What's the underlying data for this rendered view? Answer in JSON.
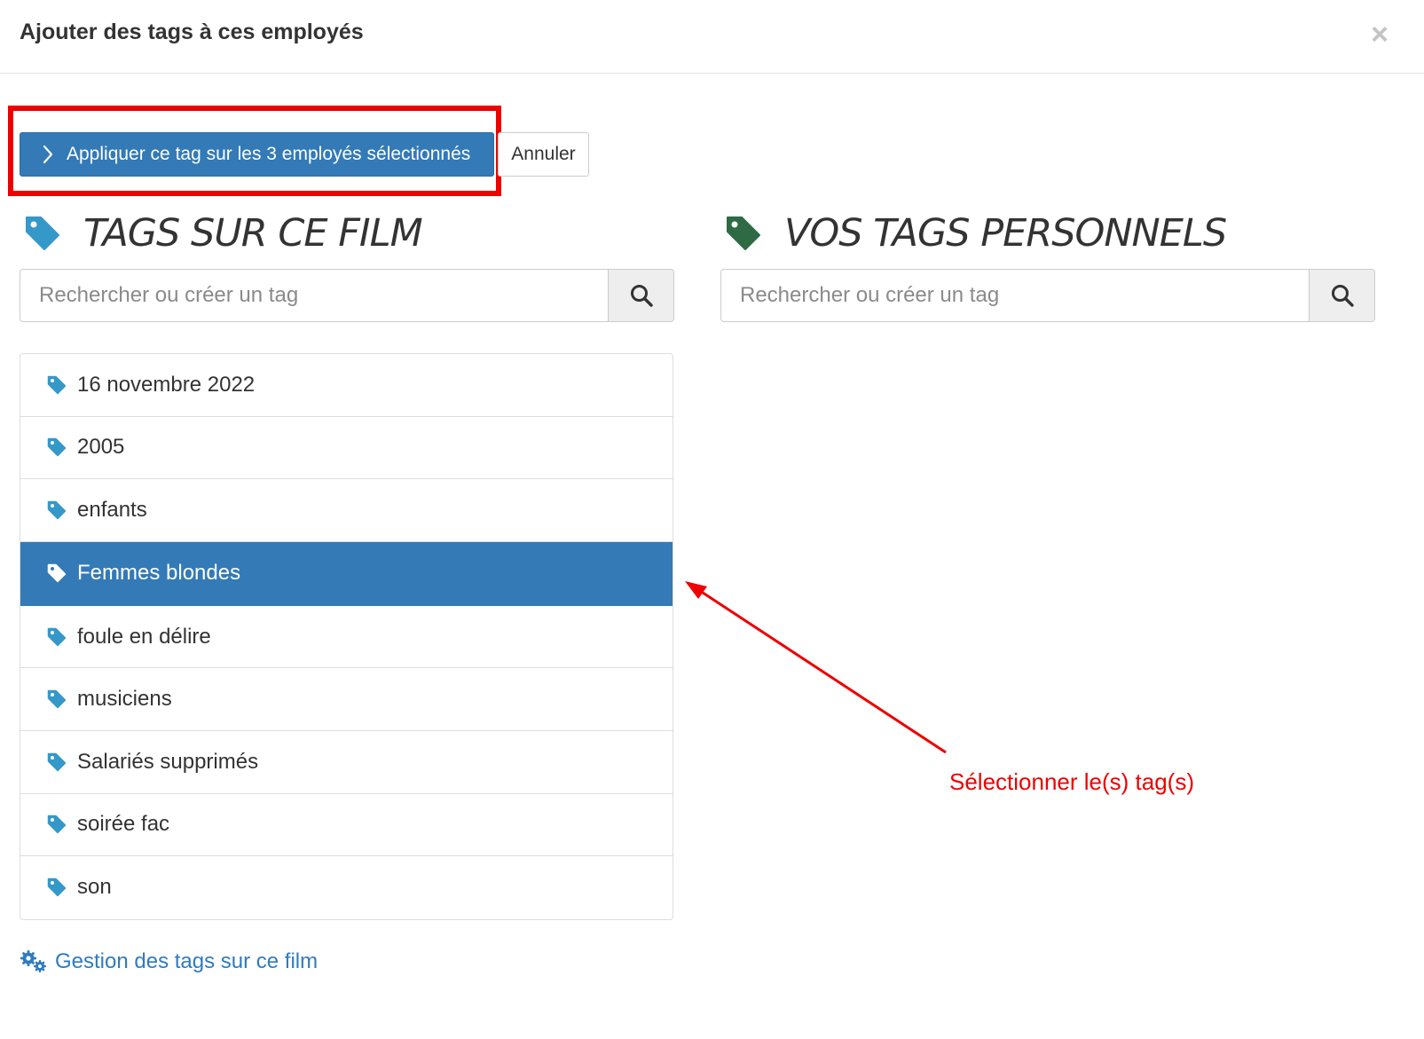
{
  "modal": {
    "title": "Ajouter des tags à ces employés",
    "close_label": "×"
  },
  "actions": {
    "apply_label": "Appliquer ce tag sur les 3 employés sélectionnés",
    "cancel_label": "Annuler",
    "highlight_color": "#ee0000"
  },
  "film_tags": {
    "heading": "TAGS SUR CE FILM",
    "icon": "tag-icon",
    "icon_color": "#3498c9",
    "search_placeholder": "Rechercher ou créer un tag",
    "items": [
      {
        "label": "16 novembre 2022",
        "selected": false
      },
      {
        "label": "2005",
        "selected": false
      },
      {
        "label": "enfants",
        "selected": false
      },
      {
        "label": "Femmes blondes",
        "selected": true
      },
      {
        "label": "foule en délire",
        "selected": false
      },
      {
        "label": "musiciens",
        "selected": false
      },
      {
        "label": "Salariés supprimés",
        "selected": false
      },
      {
        "label": "soirée fac",
        "selected": false
      },
      {
        "label": "son",
        "selected": false
      }
    ],
    "manage_link": "Gestion des tags sur ce film"
  },
  "personal_tags": {
    "heading": "VOS TAGS PERSONNELS",
    "icon": "tag-icon",
    "icon_color": "#2e6b45",
    "search_placeholder": "Rechercher ou créer un tag"
  },
  "annotation": {
    "text": "Sélectionner le(s) tag(s)",
    "color": "#ee0000"
  },
  "colors": {
    "primary": "#337ab7",
    "link": "#2f7bbf"
  }
}
